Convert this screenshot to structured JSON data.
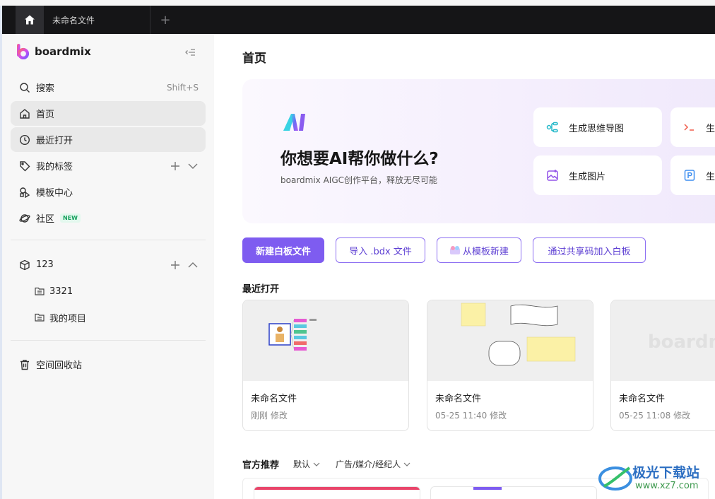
{
  "titlebar": {
    "home_icon": "home-icon",
    "tab_title": "未命名文件",
    "add_tab_glyph": "+"
  },
  "sidebar": {
    "brand": "boardmix",
    "search": {
      "label": "搜索",
      "shortcut": "Shift+S"
    },
    "nav": {
      "home": "首页",
      "recent": "最近打开",
      "tags": "我的标签",
      "templates": "模板中心",
      "community": "社区",
      "community_badge": "NEW"
    },
    "team": {
      "name": "123",
      "items": [
        "3321",
        "我的项目"
      ]
    },
    "trash": "空间回收站"
  },
  "main": {
    "page_title": "首页",
    "hero": {
      "title": "你想要AI帮你做什么?",
      "subtitle": "boardmix AIGC创作平台，释放无尽可能",
      "cards": [
        {
          "label": "生成思维导图",
          "icon": "mindmap-icon"
        },
        {
          "label": "生",
          "icon": "code-icon"
        },
        {
          "label": "生成图片",
          "icon": "image-icon"
        },
        {
          "label": "生",
          "icon": "ppt-icon"
        }
      ]
    },
    "actions": {
      "new_board": "新建白板文件",
      "import": "导入 .bdx 文件",
      "from_template": "从模板新建",
      "join_by_code": "通过共享码加入白板"
    },
    "recent_title": "最近打开",
    "recent_files": [
      {
        "name": "未命名文件",
        "time": "刚刚 修改"
      },
      {
        "name": "未命名文件",
        "time": "05-25 11:40 修改"
      },
      {
        "name": "未命名文件",
        "time": "05-25 11:08 修改",
        "thumb_text": "boardmi"
      }
    ],
    "recommend": {
      "title": "官方推荐",
      "filter_default": "默认",
      "filter_category": "广告/媒介/经纪人"
    }
  },
  "watermark": {
    "text": "极光下载站",
    "url": "www.xz7.com"
  },
  "colors": {
    "accent": "#7e5cf0",
    "titlebar": "#151517",
    "sidebar": "#f7f7f7"
  }
}
